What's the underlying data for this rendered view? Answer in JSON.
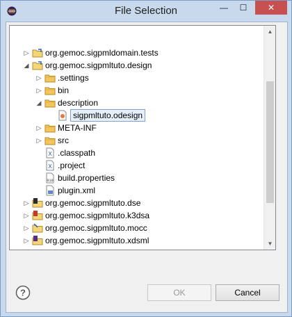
{
  "window": {
    "title": "File Selection",
    "min_glyph": "—",
    "max_glyph": "☐",
    "close_glyph": "✕"
  },
  "tree": {
    "rows": [
      {
        "label": "org.gemoc.sigpmldomain.tests",
        "icon": "project-icon",
        "expander": "▷",
        "level": 0
      },
      {
        "label": "org.gemoc.sigpmltuto.design",
        "icon": "project-icon",
        "expander": "◢",
        "level": 0
      },
      {
        "label": ".settings",
        "icon": "folder-icon",
        "expander": "▷",
        "level": 1
      },
      {
        "label": "bin",
        "icon": "folder-icon",
        "expander": "▷",
        "level": 1
      },
      {
        "label": "description",
        "icon": "folder-icon",
        "expander": "◢",
        "level": 1
      },
      {
        "label": "sigpmltuto.odesign",
        "icon": "odesign-file-icon",
        "expander": "",
        "level": 2,
        "selected": true
      },
      {
        "label": "META-INF",
        "icon": "folder-icon",
        "expander": "▷",
        "level": 1
      },
      {
        "label": "src",
        "icon": "folder-icon",
        "expander": "▷",
        "level": 1
      },
      {
        "label": ".classpath",
        "icon": "xml-file-icon",
        "expander": "",
        "level": 1
      },
      {
        "label": ".project",
        "icon": "xml-file-icon",
        "expander": "",
        "level": 1
      },
      {
        "label": "build.properties",
        "icon": "properties-file-icon",
        "expander": "",
        "level": 1
      },
      {
        "label": "plugin.xml",
        "icon": "plugin-file-icon",
        "expander": "",
        "level": 1
      },
      {
        "label": "org.gemoc.sigpmltuto.dse",
        "icon": "dse-project-icon",
        "expander": "▷",
        "level": 0
      },
      {
        "label": "org.gemoc.sigpmltuto.k3dsa",
        "icon": "k3dsa-project-icon",
        "expander": "▷",
        "level": 0
      },
      {
        "label": "org.gemoc.sigpmltuto.mocc",
        "icon": "mocc-project-icon",
        "expander": "▷",
        "level": 0
      },
      {
        "label": "org.gemoc.sigpmltuto.xdsml",
        "icon": "xdsml-project-icon",
        "expander": "▷",
        "level": 0
      }
    ]
  },
  "scrollbar": {
    "up_glyph": "▲",
    "down_glyph": "▼"
  },
  "buttons": {
    "help_glyph": "?",
    "ok_label": "OK",
    "cancel_label": "Cancel"
  }
}
